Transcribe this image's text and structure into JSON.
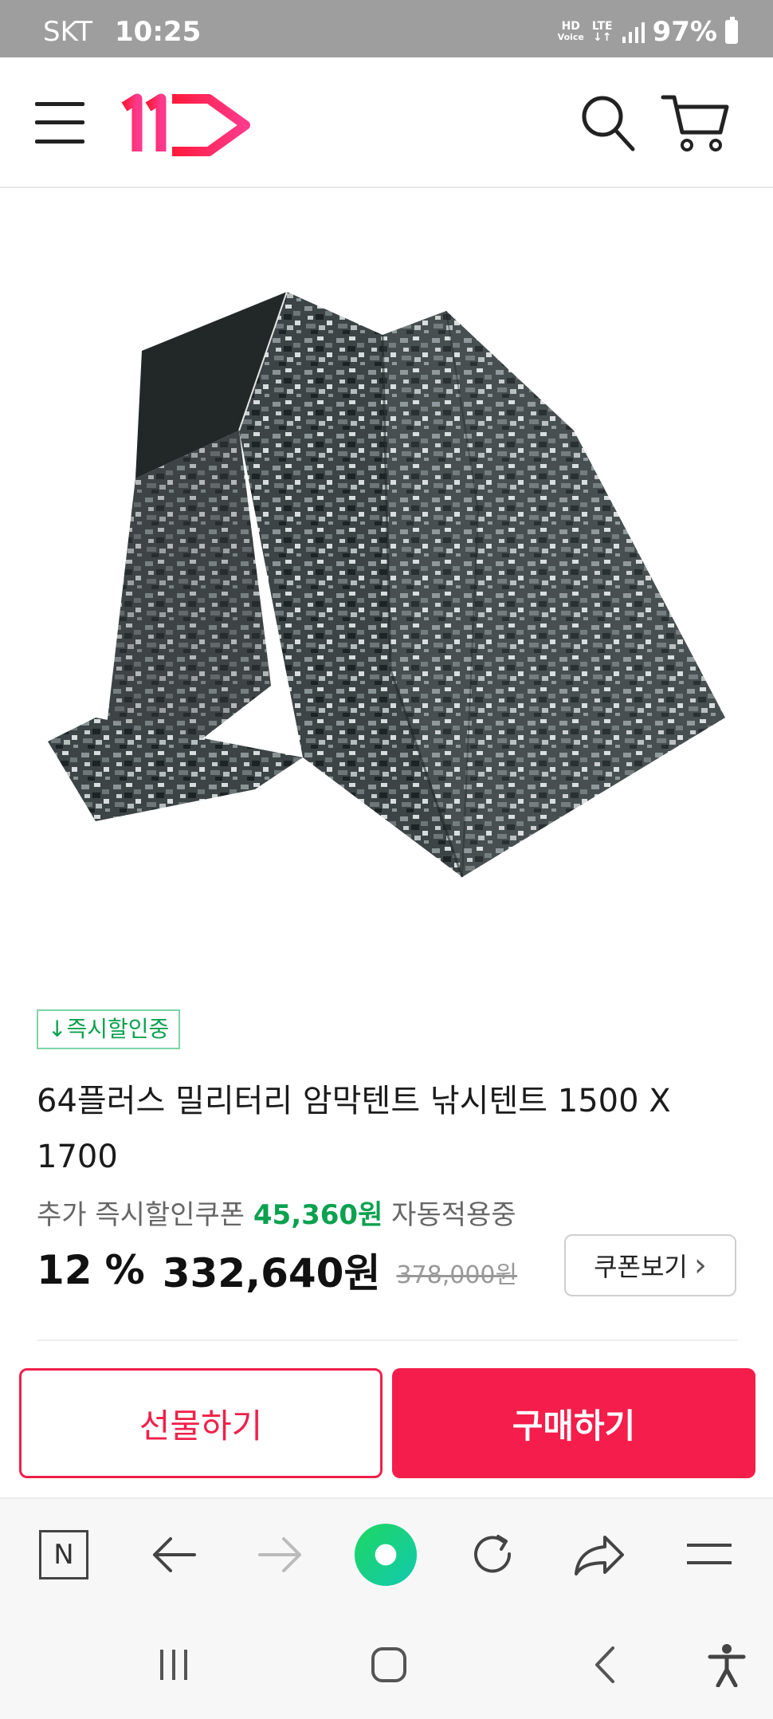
{
  "status_bar": {
    "carrier": "SKT",
    "time": "10:25",
    "hd_label": "HD",
    "voice_label": "Voice",
    "lte_label": "LTE",
    "battery": "97%"
  },
  "header": {
    "logo_text": "11",
    "brand_color": "#f0204a"
  },
  "product": {
    "image_alt": "digital camo military tent",
    "badge": "↓즉시할인중",
    "title": "64플러스 밀리터리 암막텐트 낚시텐트 1500 X 1700",
    "coupon_prefix": "추가 즉시할인쿠폰",
    "coupon_amount": "45,360원",
    "coupon_suffix": "자동적용중",
    "discount_rate": "12",
    "discount_unit": "%",
    "price": "332,640원",
    "original_price": "378,000원",
    "coupon_button": "쿠폰보기",
    "coupon_button_chevron": "›"
  },
  "actions": {
    "gift_label": "선물하기",
    "buy_label": "구매하기"
  },
  "browser_toolbar": {
    "home_label": "N",
    "icons": [
      "naver-home-icon",
      "back-arrow-icon",
      "forward-arrow-icon",
      "green-dot-icon",
      "refresh-icon",
      "share-icon",
      "menu-icon"
    ]
  },
  "colors": {
    "accent": "#f51d4b",
    "discount_green": "#0aa14f",
    "status_bar": "#9e9e9e"
  }
}
